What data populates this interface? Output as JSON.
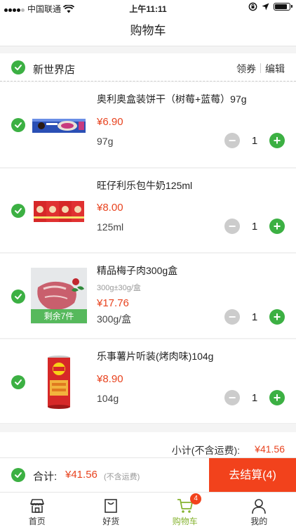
{
  "status_bar": {
    "carrier": "中国联通",
    "time": "上午11:11"
  },
  "nav": {
    "title": "购物车"
  },
  "store": {
    "name": "新世界店",
    "coupon_label": "领券",
    "edit_label": "编辑"
  },
  "items": [
    {
      "title": "奥利奥盒装饼干（树莓+蓝莓）97g",
      "price": "¥6.90",
      "spec": "97g",
      "qty": "1",
      "image": "oreo-cookie-box"
    },
    {
      "title": "旺仔利乐包牛奶125ml",
      "price": "¥8.00",
      "spec": "125ml",
      "qty": "1",
      "image": "wangzai-milk-packs"
    },
    {
      "title": "精品梅子肉300g盒",
      "sub": "300g±30g/盒",
      "price": "¥17.76",
      "spec": "300g/盒",
      "qty": "1",
      "badge": "剩余7件",
      "image": "pork-meat-tray"
    },
    {
      "title": "乐事薯片听装(烤肉味)104g",
      "price": "¥8.90",
      "spec": "104g",
      "qty": "1",
      "image": "lays-chips-can"
    }
  ],
  "subtotal": {
    "label": "小计(不含运费):",
    "value": "¥41.56"
  },
  "total": {
    "label": "合计:",
    "amount": "¥41.56",
    "note": "(不含运费)",
    "checkout_label": "去结算(4)"
  },
  "tabs": [
    {
      "label": "首页",
      "icon": "store-icon"
    },
    {
      "label": "好货",
      "icon": "bag-icon"
    },
    {
      "label": "购物车",
      "icon": "cart-icon",
      "badge": "4",
      "active": true
    },
    {
      "label": "我的",
      "icon": "user-icon"
    }
  ],
  "colors": {
    "accent_green": "#3cb043",
    "price_red": "#e8431f",
    "checkout_orange": "#f2421c",
    "tab_active": "#86b330"
  }
}
